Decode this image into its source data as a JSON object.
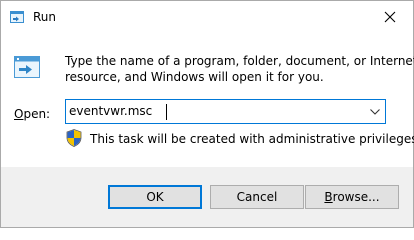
{
  "window": {
    "title": "Run",
    "close_symbol": "✕"
  },
  "description": {
    "line1": "Type the name of a program, folder, document, or Internet",
    "line2": "resource, and Windows will open it for you."
  },
  "open_field": {
    "label_underlined": "O",
    "label_rest": "pen:",
    "value": "eventvwr.msc"
  },
  "admin_note": "This task will be created with administrative privileges.",
  "buttons": {
    "ok": "OK",
    "cancel": "Cancel",
    "browse_underlined": "B",
    "browse_rest": "rowse..."
  },
  "icons": {
    "title": "run-icon",
    "close": "close-icon",
    "dialog": "run-dialog-icon",
    "dropdown": "chevron-down-icon",
    "uac": "uac-shield-icon"
  },
  "colors": {
    "accent": "#0078d7",
    "footer_bg": "#f0f0f0",
    "button_bg": "#e1e1e1"
  }
}
